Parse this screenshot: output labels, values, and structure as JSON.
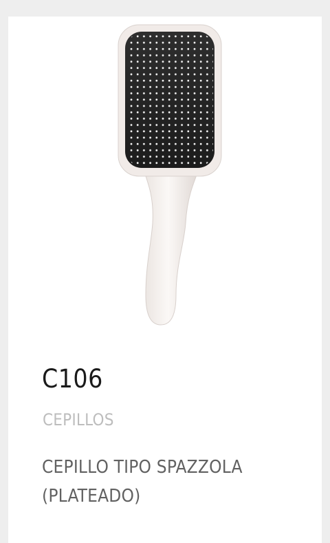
{
  "product": {
    "image_icon": "paddle-hairbrush-icon",
    "sku": "C106",
    "category": "CEPILLOS",
    "description": "CEPILLO TIPO SPAZZOLA (PLATEADO)"
  },
  "colors": {
    "background": "#eeeeee",
    "card": "#ffffff",
    "sku_text": "#1a1a1a",
    "category_text": "#bdbdbd",
    "description_text": "#616161"
  }
}
